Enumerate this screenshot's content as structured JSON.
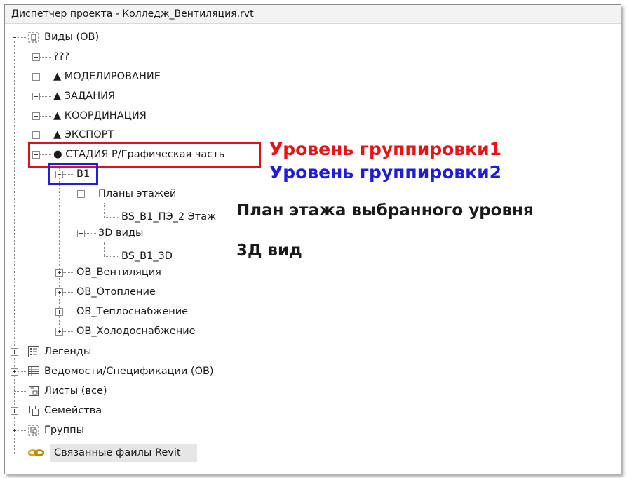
{
  "window": {
    "title": "Диспетчер проекта - Колледж_Вентиляция.rvt"
  },
  "tree": {
    "views": {
      "label": "Виды (ОВ)",
      "children": [
        "???",
        "▲ МОДЕЛИРОВАНИЕ",
        "▲ ЗАДАНИЯ",
        "▲ КООРДИНАЦИЯ",
        "▲ ЭКСПОРТ"
      ],
      "stage": {
        "label": "● СТАДИЯ Р/Графическая часть",
        "level": {
          "label": "В1",
          "floor_plans": {
            "label": "Планы этажей",
            "item": "BS_В1_ПЭ_2 Этаж"
          },
          "views_3d": {
            "label": "3D виды",
            "item": "BS_В1_3D"
          }
        },
        "systems": [
          "ОВ_Вентиляция",
          "ОВ_Отопление",
          "ОВ_Теплоснабжение",
          "ОВ_Холодоснабжение"
        ]
      }
    },
    "legends": "Легенды",
    "schedules": "Ведомости/Спецификации (ОВ)",
    "sheets": "Листы (все)",
    "families": "Семейства",
    "groups": "Группы",
    "linked": "Связанные файлы Revit"
  },
  "annotations": {
    "group_level_1": "Уровень группировки1",
    "group_level_2": "Уровень группировки2",
    "floor_plan_note": "План этажа выбранного уровня",
    "view_3d_note": "3Д вид"
  },
  "colors": {
    "red": "#e01018",
    "blue": "#1e1ee0"
  }
}
